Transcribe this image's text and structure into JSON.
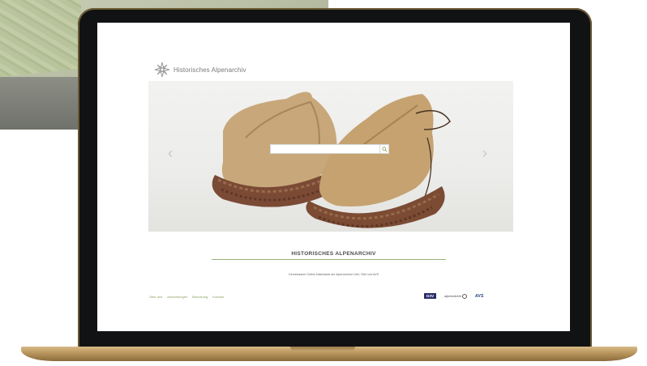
{
  "site": {
    "logo_text": "Historisches Alpenarchiv",
    "section_title": "HISTORISCHES ALPENARCHIV",
    "subline": "Gemeinsame Online-Datenbank der Alpenvereine DAV, ÖAV und AVS"
  },
  "search": {
    "placeholder": "",
    "value": ""
  },
  "hero": {
    "prev_icon": "‹",
    "next_icon": "›"
  },
  "footer": {
    "links": [
      {
        "label": "Über uns"
      },
      {
        "label": "Anmerkungen"
      },
      {
        "label": "Benutzung"
      },
      {
        "label": "Kontakt"
      }
    ]
  },
  "partners": {
    "dav": "DAV",
    "oeav": "alpenverein",
    "avs": "AVS"
  },
  "colors": {
    "accent": "#8aa35c",
    "rule": "#9cb27a",
    "dav_blue": "#2a2d6b",
    "avs_blue": "#1f3c77"
  }
}
